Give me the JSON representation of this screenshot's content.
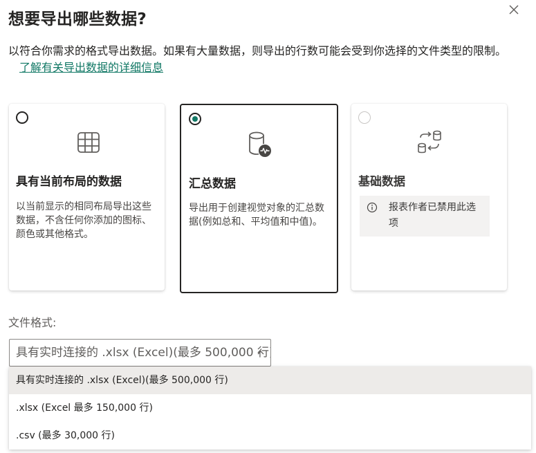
{
  "dialog": {
    "title": "想要导出哪些数据?",
    "description": "以符合你需求的格式导出数据。如果有大量数据，则导出的行数可能会受到你选择的文件类型的限制。",
    "learn_more_link": "了解有关导出数据的详细信息"
  },
  "options": [
    {
      "title": "具有当前布局的数据",
      "description": "以当前显示的相同布局导出这些数据，不含任何你添加的图标、颜色或其他格式。",
      "icon": "table-grid-icon",
      "selected": false,
      "disabled": false
    },
    {
      "title": "汇总数据",
      "description": "导出用于创建视觉对象的汇总数据(例如总和、平均值和中值)。",
      "icon": "database-pulse-icon",
      "selected": true,
      "disabled": false
    },
    {
      "title": "基础数据",
      "info_message": "报表作者已禁用此选项",
      "icon": "data-transfer-icon",
      "selected": false,
      "disabled": true
    }
  ],
  "file_format": {
    "label": "文件格式:",
    "selected_value": "具有实时连接的 .xlsx (Excel)(最多 500,000 行)",
    "options": [
      "具有实时连接的 .xlsx (Excel)(最多 500,000 行)",
      ".xlsx (Excel 最多 150,000 行)",
      ".csv (最多 30,000 行)"
    ]
  },
  "colors": {
    "accent": "#117865",
    "text": "#252423",
    "selected_option_bg": "#edebe9",
    "info_box_bg": "#f3f2f1"
  }
}
